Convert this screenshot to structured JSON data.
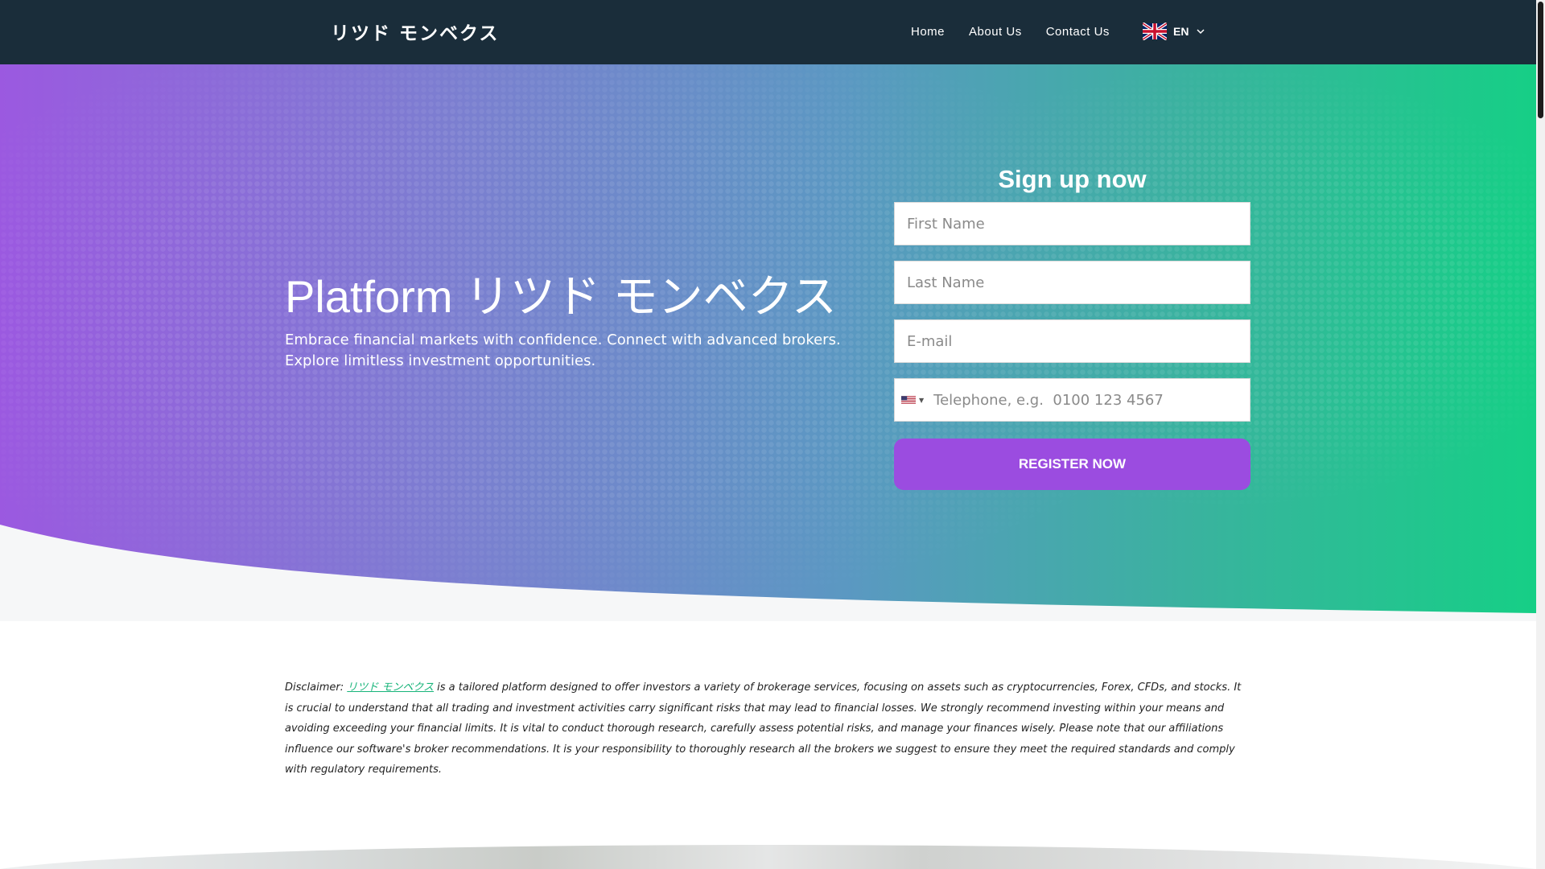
{
  "header": {
    "brand": "リツド モンベクス",
    "nav": [
      {
        "label": "Home"
      },
      {
        "label": "About Us"
      },
      {
        "label": "Contact Us"
      }
    ],
    "language": {
      "code": "EN",
      "flag_icon": "uk-flag-icon"
    }
  },
  "hero": {
    "title": "Platform リツド モンベクス",
    "subtitle": "Embrace financial markets with confidence. Connect with advanced brokers. Explore limitless investment opportunities."
  },
  "signup": {
    "heading": "Sign up now",
    "first_name_placeholder": "First Name",
    "last_name_placeholder": "Last Name",
    "email_placeholder": "E-mail",
    "phone_placeholder": "Telephone, e.g.  0100 123 4567",
    "phone_country_icon": "us-flag-icon",
    "button_label": "REGISTER NOW"
  },
  "disclaimer": {
    "prefix": "Disclaimer: ",
    "brand_link": "リツド モンベクス",
    "text": " is a tailored platform designed to offer investors a variety of brokerage services, focusing on assets such as cryptocurrencies, Forex, CFDs, and stocks. It is crucial to understand that all trading and investment activities carry significant risks that may lead to financial losses. We strongly recommend investing within your means and avoiding exceeding your financial limits. It is vital to conduct thorough research, carefully assess potential risks, and manage your finances wisely. Please note that our affiliations influence our software's broker recommendations. It is your responsibility to thoroughly research all the brokers we suggest to ensure they meet the required standards and comply with regulatory requirements."
  },
  "colors": {
    "header_bg": "#1a2d3a",
    "gradient_start": "#9b59e0",
    "gradient_end": "#16cf86",
    "button": "#9b4ce0",
    "link": "#18b47a"
  }
}
